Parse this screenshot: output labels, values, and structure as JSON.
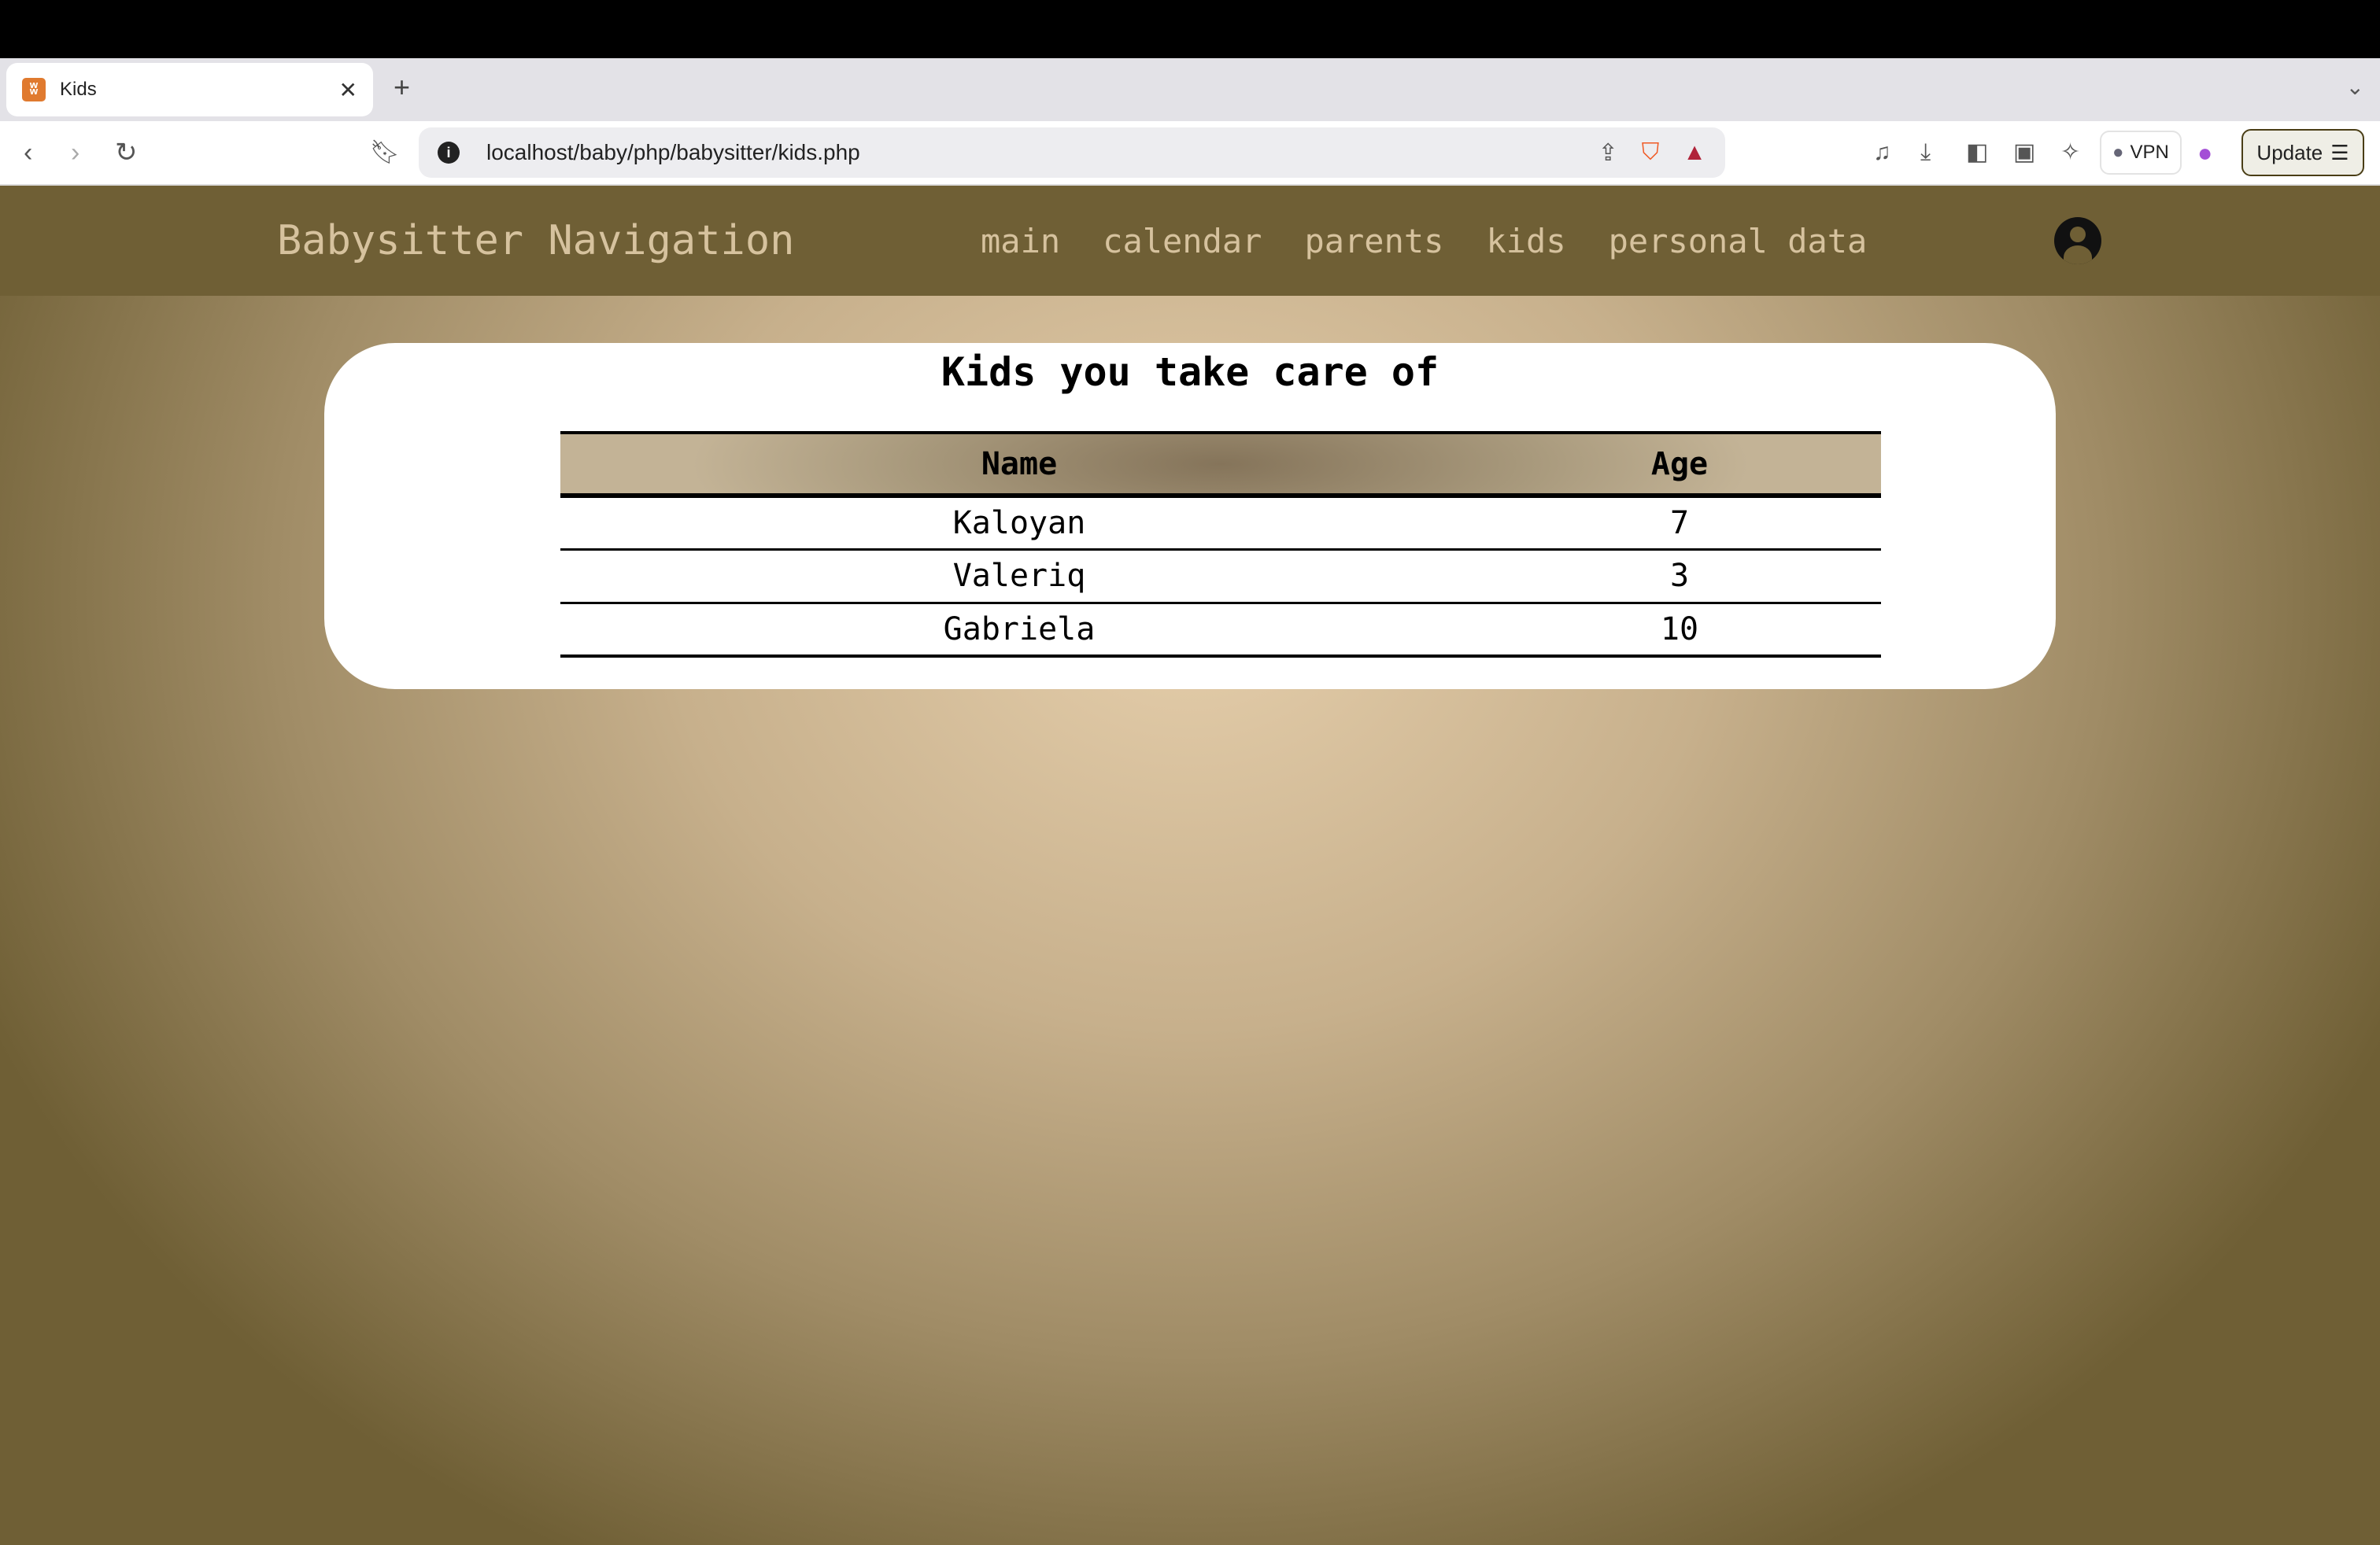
{
  "browser": {
    "tab_title": "Kids",
    "url": "localhost/baby/php/babysitter/kids.php",
    "vpn_label": "VPN",
    "update_label": "Update"
  },
  "nav": {
    "brand": "Babysitter Navigation",
    "links": [
      "main",
      "calendar",
      "parents",
      "kids",
      "personal data"
    ]
  },
  "main": {
    "title": "Kids you take care of",
    "columns": [
      "Name",
      "Age"
    ],
    "rows": [
      [
        "Kaloyan",
        "7"
      ],
      [
        "Valeriq",
        "3"
      ],
      [
        "Gabriela",
        "10"
      ]
    ]
  }
}
